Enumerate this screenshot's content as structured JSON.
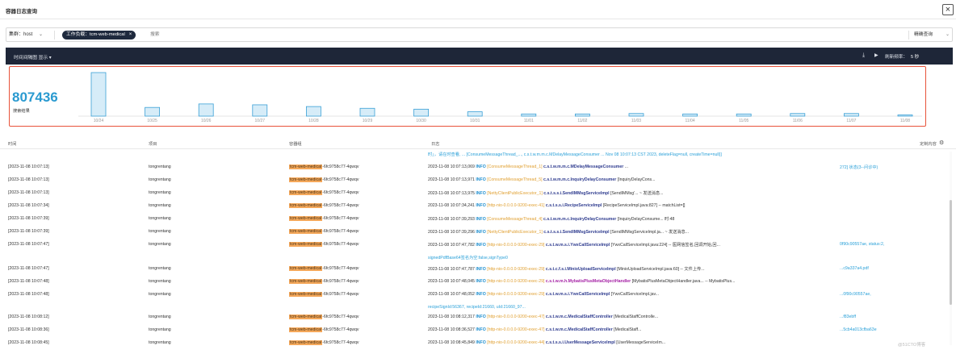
{
  "window": {
    "title": "容器日志查询",
    "close_icon": "×"
  },
  "filter": {
    "cluster_label": "集群：host",
    "cluster_chevron": "⌄",
    "tag_label": "工作负载：tcm-web-medical",
    "tag_close": "×",
    "search_placeholder": "搜索",
    "mode_label": "精确查询",
    "mode_chevron": "⌄"
  },
  "histogram": {
    "header_label": "时间间隔图 显示 ▾",
    "refresh_label": "刷新频率：",
    "refresh_value": "5 秒",
    "total_count": "807436",
    "total_label": "搜索结果"
  },
  "chart_data": {
    "type": "bar",
    "categories": [
      "10/24",
      "10/25",
      "10/26",
      "10/27",
      "10/28",
      "10/29",
      "10/30",
      "10/31",
      "11/01",
      "11/02",
      "11/03",
      "11/04",
      "11/05",
      "11/06",
      "11/07",
      "11/08"
    ],
    "values": [
      100,
      20,
      28,
      26,
      22,
      18,
      16,
      10,
      5,
      5,
      6,
      5,
      5,
      6,
      6,
      2
    ]
  },
  "table": {
    "columns": {
      "time": "时间",
      "project": "项目",
      "container": "容器组",
      "log": "日志",
      "custom": "定制内容"
    },
    "gear_icon": "⚙",
    "top_partial": "时」，请在时查看, ... [ConsumeMessageThread_..., c.s.t.w.m.m.c.MDelayMessageConsumer ... Nov 08 10:07:13 CST 2023, deleteFlag=null, createTime=null}]",
    "rows": [
      {
        "time": "[2023-11-08 10:07:13]",
        "project": "tongrentang",
        "container_hl": "tcm-web-medical",
        "container_rest": "-6fc9758c77-4qwqv",
        "ts": "2023-11-08 10:07:13,069",
        "level": "INFO",
        "thread": "[ConsumeMessageThread_1]",
        "cls": "c.s.t.w.m.m.c.MDelayMessageConsumer",
        "cls_m": false,
        "rest": " ...",
        "tail": "272] 状态(3--问诊中)"
      },
      {
        "time": "[2023-11-08 10:07:13]",
        "project": "tongrentang",
        "container_hl": "tcm-web-medical",
        "container_rest": "-6fc9758c77-4qwqv",
        "ts": "2023-11-08 10:07:13,971",
        "level": "INFO",
        "thread": "[ConsumeMessageThread_5]",
        "cls": "c.s.t.w.m.m.c.InquiryDelayConsumer",
        "cls_m": false,
        "rest": " [InquiryDelayCons...",
        "tail": ""
      },
      {
        "time": "[2023-11-08 10:07:13]",
        "project": "tongrentang",
        "container_hl": "tcm-web-medical",
        "container_rest": "-6fc9758c77-4qwqv",
        "ts": "2023-11-08 10:07:13,975",
        "level": "INFO",
        "thread": "[NettyClientPublicExecutor_1]",
        "cls": "c.s.t.s.s.i.SendIMMsgServiceImpl",
        "cls_m": false,
        "rest": " [SendIMMsg'... ~ 发送消息...",
        "tail": ""
      },
      {
        "time": "[2023-11-08 10:07:34]",
        "project": "tongrentang",
        "container_hl": "tcm-web-medical",
        "container_rest": "-6fc9758c77-4qwqv",
        "ts": "2023-11-08 10:07:34,241",
        "level": "INFO",
        "thread": "[http-nio-0.0.0.0-9200-exec-41]",
        "cls": "c.s.t.s.s.i.RecipeServiceImpl",
        "cls_m": false,
        "rest": " [RecipeServiceImpl.java:827] -- matchList=[]",
        "tail": ""
      },
      {
        "time": "[2023-11-08 10:07:39]",
        "project": "tongrentang",
        "container_hl": "tcm-web-medical",
        "container_rest": "-6fc9758c77-4qwqv",
        "ts": "2023-11-08 10:07:39,293",
        "level": "INFO",
        "thread": "[ConsumeMessageThread_4]",
        "cls": "c.s.t.w.m.m.c.InquiryDelayConsumer",
        "cls_m": false,
        "rest": " [InquiryDelayConsume... 时:48",
        "tail": ""
      },
      {
        "time": "[2023-11-08 10:07:39]",
        "project": "tongrentang",
        "container_hl": "tcm-web-medical",
        "container_rest": "-6fc9758c77-4qwqv",
        "ts": "2023-11-08 10:07:39,296",
        "level": "INFO",
        "thread": "[NettyClientPublicExecutor_1]",
        "cls": "c.s.t.s.s.i.SendIMMsgServiceImpl",
        "cls_m": false,
        "rest": " [SendIMMsgServiceImpl.ja... ~ 发送消息...",
        "tail": ""
      },
      {
        "time": "[2023-11-08 10:07:47]",
        "project": "tongrentang",
        "container_hl": "tcm-web-medical",
        "container_rest": "-6fc9758c77-4qwqv",
        "ts": "2023-11-08 10:07:47,782",
        "level": "INFO",
        "thread": "[http-nio-0.0.0.0-9200-exec-29]",
        "cls": "c.s.t.w.m.s.i.YwxCallServiceImpl",
        "cls_m": false,
        "rest": " [YwxCallServiceImpl.java:224] -- 医网信签名,回调开始,回... ",
        "tail": "0f90c90557ae, status:2,"
      },
      {
        "time": "[2023-11-08 10:07:47]",
        "project": "tongrentang",
        "container_hl": "tcm-web-medical",
        "container_rest": "-6fc9758c77-4qwqv",
        "ts": "2023-11-08 10:07:47,787",
        "level": "INFO",
        "thread": "[http-nio-0.0.0.0-9200-exec-29]",
        "cls": "c.s.t.c.f.s.i.MinioUploadServiceImpl",
        "cls_m": false,
        "rest": " [MinioUploadServiceImpl.java:60] -- 文件上传...",
        "tail": "...c9a337a4.pdf"
      },
      {
        "time": "[2023-11-08 10:07:48]",
        "project": "tongrentang",
        "container_hl": "tcm-web-medical",
        "container_rest": "-6fc9758c77-4qwqv",
        "ts": "2023-11-08 10:07:48,045",
        "level": "INFO",
        "thread": "[http-nio-0.0.0.0-9200-exec-29]",
        "cls": "c.s.t.w.m.h.MybatisPlusMetaObjectHandler",
        "cls_m": true,
        "rest": " [MybatisPlusMetaObjectHandler.java... -- MybatisPlus...",
        "tail": ""
      },
      {
        "time": "[2023-11-08 10:07:48]",
        "project": "tongrentang",
        "container_hl": "tcm-web-medical",
        "container_rest": "-6fc9758c77-4qwqv",
        "ts": "2023-11-08 10:07:48,052",
        "level": "INFO",
        "thread": "[http-nio-0.0.0.0-9200-exec-29]",
        "cls": "c.s.t.w.m.s.i.YwxCallServiceImpl",
        "cls_m": false,
        "rest": " [YwxCallServiceImpl.jav...",
        "tail": "...0f90c90557ae,"
      },
      {
        "time": "[2023-11-08 10:08:12]",
        "project": "tongrentang",
        "container_hl": "tcm-web-medical",
        "container_rest": "-6fc9758c77-4qwqv",
        "ts": "2023-11-08 10:08:12,317",
        "level": "INFO",
        "thread": "[http-nio-0.0.0.0-9200-exec-47]",
        "cls": "c.s.t.w.m.c.MedicalStaffController",
        "cls_m": false,
        "rest": " [MedicalStaffControlle... ",
        "tail": "...f83ebff"
      },
      {
        "time": "[2023-11-08 10:08:36]",
        "project": "tongrentang",
        "container_hl": "tcm-web-medical",
        "container_rest": "-6fc9758c77-4qwqv",
        "ts": "2023-11-08 10:08:36,527",
        "level": "INFO",
        "thread": "[http-nio-0.0.0.0-9200-exec-47]",
        "cls": "c.s.t.w.m.c.MedicalStaffController",
        "cls_m": false,
        "rest": " [MedicalStaff...",
        "tail": "...5cb4a013cfba63e"
      },
      {
        "time": "[2023-11-08 10:08:45]",
        "project": "tongrentang",
        "container_hl": "tcm-web-medical",
        "container_rest": "-6fc9758c77-4qwqv",
        "ts": "2023-11-08 10:08:45,849",
        "level": "INFO",
        "thread": "[http-nio-0.0.0.0-9200-exec-44]",
        "cls": "c.s.t.s.s.i.UserMessageServiceImpl",
        "cls_m": false,
        "rest": " [UserMessageServiceIm...",
        "tail": ""
      }
    ],
    "continuations": {
      "6": "signedPdfBase64签名为空:false,signType0",
      "9": "recipeSignId:56367, recipeId:21660, uId:21660_97..."
    }
  },
  "watermark": "@51CTO博客"
}
